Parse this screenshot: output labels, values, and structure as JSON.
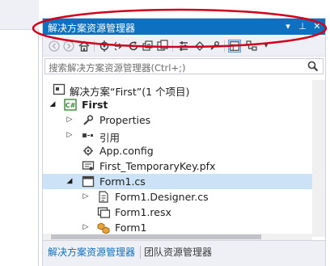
{
  "panel": {
    "title": "解决方案资源管理器",
    "title_buttons": [
      "▾",
      "⊥",
      "✕"
    ]
  },
  "toolbar": {
    "icons": [
      "back-icon",
      "forward-icon",
      "home-icon",
      "sync-icon",
      "pending-changes-icon",
      "refresh-icon",
      "collapse-all-icon",
      "show-all-files-icon",
      "properties-icon",
      "preview-icon",
      "class-view-icon",
      "dropdown-icon"
    ]
  },
  "search": {
    "placeholder": "搜索解决方案资源管理器(Ctrl+;)"
  },
  "tree": {
    "solution": "解决方案“First”(1 个项目)",
    "project": "First",
    "items": {
      "properties": "Properties",
      "references": "引用",
      "app_config": "App.config",
      "key_file": "First_TemporaryKey.pfx",
      "form1": "Form1.cs",
      "form1_designer": "Form1.Designer.cs",
      "form1_resx": "Form1.resx",
      "form1_class": "Form1"
    }
  },
  "tabs": {
    "solution_explorer": "解决方案资源管理器",
    "team_explorer": "团队资源管理器"
  },
  "colors": {
    "title_bar": "#0e70c0",
    "selection": "#cce2f6",
    "highlight_ellipse": "#d0021b",
    "active_tab": "#0e70c0"
  }
}
